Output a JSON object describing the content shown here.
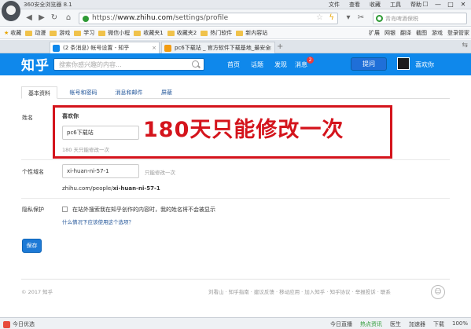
{
  "browser": {
    "title": "360安全浏览器 8.1",
    "menu": [
      "文件",
      "查看",
      "收藏",
      "工具",
      "帮助"
    ],
    "window_controls": [
      "☐",
      "—",
      "□",
      "✕"
    ],
    "url_prefix": "https://",
    "url_domain": "www.zhihu.com",
    "url_path": "/settings/profile",
    "search_placeholder": "青岛啤酒保税",
    "bookmarks": [
      "收藏",
      "动漫",
      "游戏",
      "学习",
      "微信小程",
      "收藏夹1",
      "收藏夹2",
      "热门软件",
      "新内容站"
    ],
    "bookmarks_right": [
      "扩展",
      "网银",
      "翻译",
      "截图",
      "游戏",
      "登录管家"
    ],
    "tabs": [
      {
        "label": "(2 条消息) 帐号设置 - 知乎",
        "active": true,
        "icon_color": "#0f88eb"
      },
      {
        "label": "pc6下载站 _ 官方软件下载基地_最安全",
        "active": false,
        "icon_color": "#f39c12"
      }
    ],
    "new_tab": "+",
    "tab_right": "⇆"
  },
  "zhihu": {
    "logo": "知乎",
    "search_placeholder": "搜索你感兴趣的内容...",
    "nav": [
      "首页",
      "话题",
      "发现",
      "消息"
    ],
    "message_badge": "2",
    "ask_button": "提问",
    "username": "喜欢你"
  },
  "settings": {
    "tabs": [
      "基本资料",
      "帐号和密码",
      "消息和邮件",
      "屏蔽"
    ],
    "name_label": "姓名",
    "name_current": "喜欢你",
    "name_input_value": "pc6下载站",
    "name_hint": "180 天只能修改一次",
    "annotation": "180天只能修改一次",
    "domain_label": "个性域名",
    "domain_input_value": "xi-huan-ni-57-1",
    "domain_hint": "只能修改一次",
    "domain_url_prefix": "zhihu.com/people/",
    "domain_url_slug": "xi-huan-ni-57-1",
    "privacy_label": "隐私保护",
    "privacy_option": "在站外搜索我在知乎创作的内容时，我的姓名将不会被显示",
    "privacy_link": "什么情况下应该使用这个选项？",
    "save_button": "保存"
  },
  "footer": {
    "copyright": "© 2017 知乎",
    "links": "刘看山 · 知乎指南 · 建议反馈 · 移动应用 · 加入知乎 · 知乎协议 · 举报投诉 · 联系",
    "help_icon_glyph": "☺"
  },
  "statusbar": {
    "left": "今日优选",
    "right": [
      "今日直播",
      "热点资讯",
      "医生",
      "加速器",
      "下载",
      "100%"
    ]
  },
  "colors": {
    "zhihu_blue": "#0f88eb",
    "annotation_red": "#d4141c",
    "save_blue": "#1d7ad6"
  }
}
